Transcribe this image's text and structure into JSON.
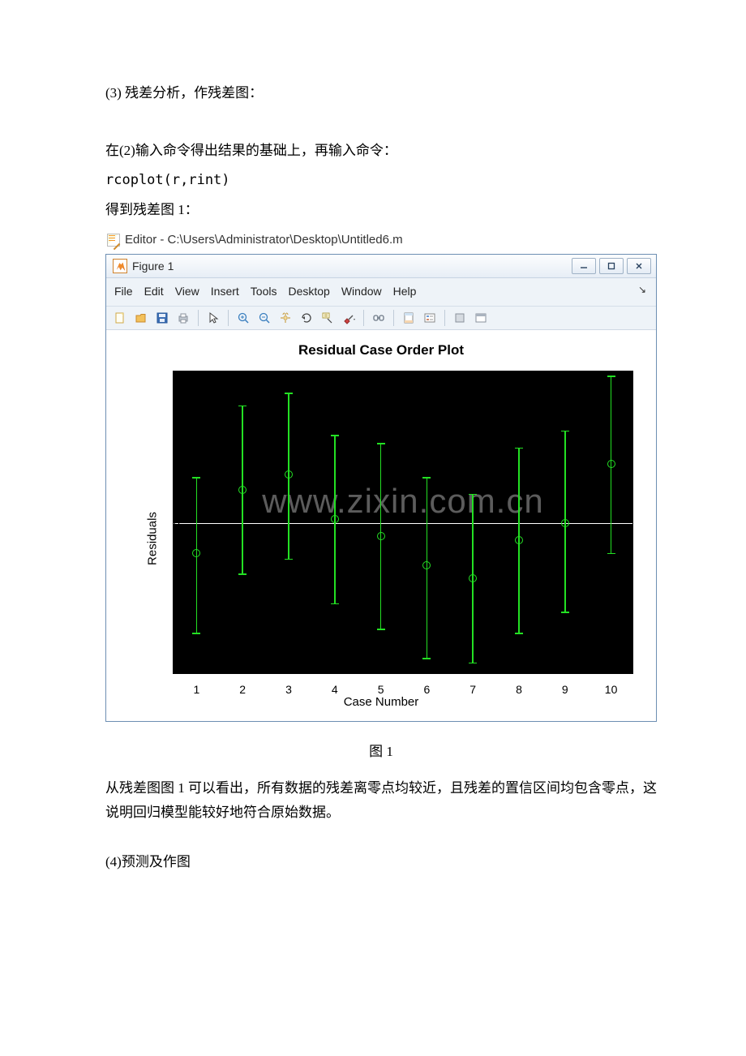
{
  "text": {
    "line1": "(3) 残差分析，作残差图：",
    "line2": "在(2)输入命令得出结果的基础上，再输入命令：",
    "line3": "rcoplot(r,rint)",
    "line4": "得到残差图 1：",
    "caption": "图 1",
    "line5": "从残差图图 1 可以看出，所有数据的残差离零点均较近，且残差的置信区间均包含零点，这说明回归模型能较好地符合原始数据。",
    "line6": "(4)预测及作图"
  },
  "editor": {
    "path": "Editor - C:\\Users\\Administrator\\Desktop\\Untitled6.m"
  },
  "figure": {
    "title": "Figure 1",
    "menus": [
      "File",
      "Edit",
      "View",
      "Insert",
      "Tools",
      "Desktop",
      "Window",
      "Help"
    ],
    "winbtns": {
      "min": "—",
      "max": "▢",
      "close": "✕"
    }
  },
  "toolbar_icons": [
    "new-file-icon",
    "open-icon",
    "save-icon",
    "print-icon",
    "pointer-icon",
    "zoom-in-icon",
    "zoom-out-icon",
    "pan-icon",
    "rotate-icon",
    "data-cursor-icon",
    "brush-icon",
    "link-icon",
    "colorbar-icon",
    "legend-icon",
    "hide-icon",
    "dock-icon"
  ],
  "watermark": "www.zixin.com.cn",
  "chart_data": {
    "type": "errorbar",
    "title": "Residual Case Order Plot",
    "xlabel": "Case Number",
    "ylabel": "Residuals",
    "xlim": [
      0.5,
      10.5
    ],
    "ylim": [
      -1.8,
      1.8
    ],
    "yticks": [
      -1.5,
      -1,
      -0.5,
      0,
      0.5,
      1,
      1.5
    ],
    "xticks": [
      1,
      2,
      3,
      4,
      5,
      6,
      7,
      8,
      9,
      10
    ],
    "series": [
      {
        "x": 1,
        "y": -0.35,
        "lo": -1.3,
        "hi": 0.55
      },
      {
        "x": 2,
        "y": 0.4,
        "lo": -0.6,
        "hi": 1.4
      },
      {
        "x": 3,
        "y": 0.58,
        "lo": -0.42,
        "hi": 1.55
      },
      {
        "x": 4,
        "y": 0.05,
        "lo": -0.95,
        "hi": 1.05
      },
      {
        "x": 5,
        "y": -0.15,
        "lo": -1.25,
        "hi": 0.95
      },
      {
        "x": 6,
        "y": -0.5,
        "lo": -1.6,
        "hi": 0.55
      },
      {
        "x": 7,
        "y": -0.65,
        "lo": -1.65,
        "hi": 0.35
      },
      {
        "x": 8,
        "y": -0.2,
        "lo": -1.3,
        "hi": 0.9
      },
      {
        "x": 9,
        "y": 0.0,
        "lo": -1.05,
        "hi": 1.1
      },
      {
        "x": 10,
        "y": 0.7,
        "lo": -0.35,
        "hi": 1.75
      }
    ]
  }
}
